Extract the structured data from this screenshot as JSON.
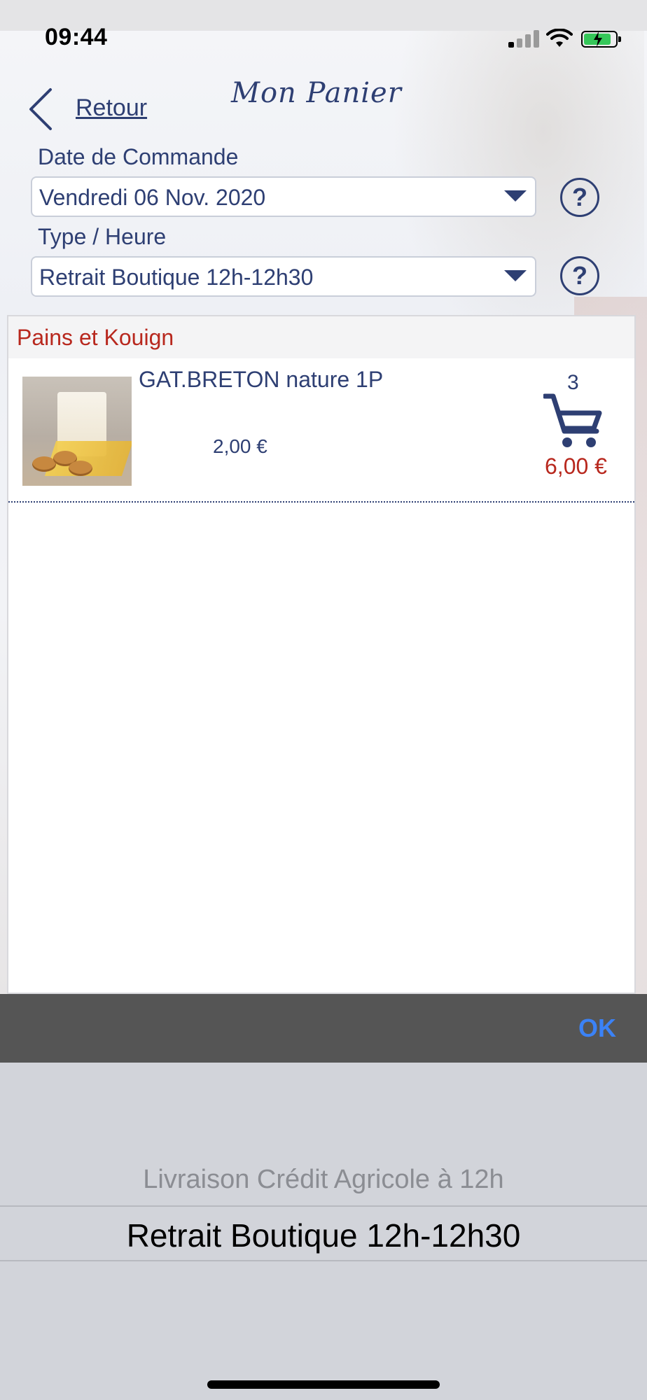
{
  "status_bar": {
    "time": "09:44"
  },
  "header": {
    "back_label": "Retour",
    "title": "Mon Panier"
  },
  "order_date": {
    "label": "Date de Commande",
    "value": "Vendredi 06 Nov. 2020"
  },
  "order_type": {
    "label": "Type / Heure",
    "value": "Retrait Boutique 12h-12h30"
  },
  "help": {
    "symbol": "?"
  },
  "cart": {
    "category": "Pains et Kouign",
    "items": [
      {
        "name": "GAT.BRETON nature 1P",
        "unit_price": "2,00 €",
        "quantity": "3",
        "total": "6,00 €"
      }
    ]
  },
  "toolbar": {
    "ok_label": "OK"
  },
  "picker": {
    "options": [
      "Livraison Crédit Agricole à 12h",
      "Retrait Boutique 12h-12h30"
    ],
    "selected": "Retrait Boutique 12h-12h30"
  },
  "colors": {
    "brand_blue": "#2e3f73",
    "accent_red": "#b8281e",
    "ok_blue": "#3b82f6"
  },
  "icons": [
    "back-chevron-icon",
    "help-icon",
    "cart-icon",
    "dropdown-caret-icon"
  ]
}
